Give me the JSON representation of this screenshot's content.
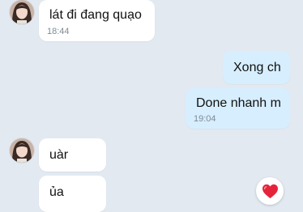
{
  "conversation": {
    "messages": [
      {
        "text": "lát đi đang quạo",
        "time": "18:44"
      },
      {
        "text": "Xong ch"
      },
      {
        "text": "Done nhanh m",
        "time": "19:04"
      },
      {
        "text": "uàr"
      },
      {
        "text": "ủa"
      }
    ]
  },
  "icons": {
    "avatar": "contact-avatar",
    "reaction": "heart-icon"
  },
  "colors": {
    "background": "#e2e9f1",
    "incoming_bubble": "#ffffff",
    "outgoing_bubble": "#d7eefe",
    "heart": "#e5243b"
  }
}
